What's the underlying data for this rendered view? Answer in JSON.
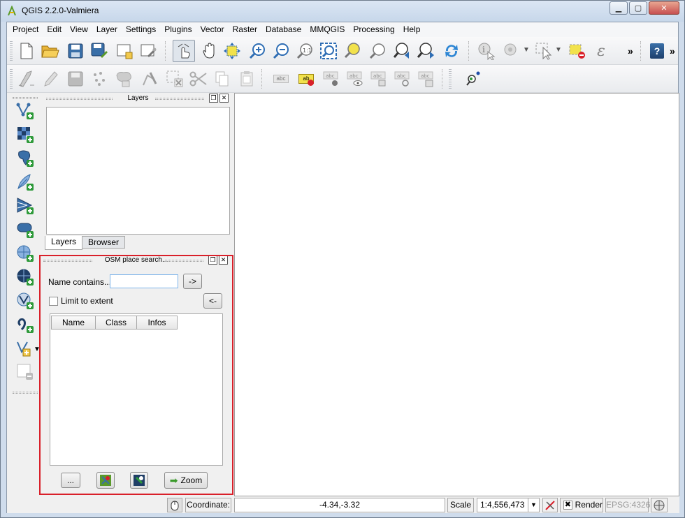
{
  "window": {
    "title": "QGIS 2.2.0-Valmiera",
    "controls": {
      "minimize": "▭",
      "maximize": "▢",
      "close": "✕"
    }
  },
  "menubar": {
    "items": [
      "Project",
      "Edit",
      "View",
      "Layer",
      "Settings",
      "Plugins",
      "Vector",
      "Raster",
      "Database",
      "MMQGIS",
      "Processing",
      "Help"
    ]
  },
  "toolbar1": {
    "icons": [
      "new-project-icon",
      "open-project-icon",
      "save-project-icon",
      "save-as-icon",
      "new-print-composer-icon",
      "composer-manager-icon",
      "touch-zoom-pan-icon",
      "pan-icon",
      "pan-to-selection-icon",
      "zoom-in-icon",
      "zoom-out-icon",
      "zoom-actual-icon",
      "zoom-full-icon",
      "zoom-selection-icon",
      "zoom-layer-icon",
      "zoom-last-icon",
      "zoom-next-icon",
      "refresh-icon",
      "identify-icon",
      "measure-icon",
      "select-icon",
      "deselect-icon",
      "expression-select-icon",
      "help-icon"
    ],
    "overflow": "»",
    "expression_glyph": "ε",
    "help_glyph": "?"
  },
  "toolbar2": {
    "icons": [
      "digitize-icon",
      "edit-pencil-icon",
      "save-edits-icon",
      "add-feature-icon",
      "move-feature-icon",
      "node-tool-icon",
      "delete-selected-icon",
      "cut-icon",
      "copy-icon",
      "paste-icon",
      "label-icon",
      "label-highlight-icon",
      "pin-label-icon",
      "show-hide-label-icon",
      "move-label-icon",
      "rotate-label-icon",
      "change-label-icon",
      "osm-search-icon"
    ],
    "label_text": "abc",
    "label_highlight_text": "ab"
  },
  "left_toolbar": {
    "icons": [
      "add-vector-layer-icon",
      "add-raster-layer-icon",
      "add-postgis-layer-icon",
      "add-spatialite-layer-icon",
      "add-mssql-layer-icon",
      "add-oracle-layer-icon",
      "add-wms-layer-icon",
      "add-wcs-layer-icon",
      "add-wfs-layer-icon",
      "add-delimited-text-icon",
      "new-shapefile-icon",
      "remove-layer-icon"
    ]
  },
  "layers_panel": {
    "title": "Layers",
    "tabs": [
      "Layers",
      "Browser"
    ],
    "float_glyph": "❐",
    "close_glyph": "✕"
  },
  "osm_panel": {
    "title": "OSM place search...",
    "name_label": "Name contains...",
    "name_value": "",
    "go_button": "->",
    "limit_label": "Limit to extent",
    "limit_checked": false,
    "back_button": "<-",
    "columns": [
      "Name",
      "Class",
      "Infos"
    ],
    "rows": [],
    "more_button": "...",
    "zoom_button": "Zoom"
  },
  "statusbar": {
    "coordinate_label": "Coordinate:",
    "coordinate_value": "-4.34,-3.32",
    "scale_label": "Scale",
    "scale_value": "1:4,556,473",
    "render_label": "Render",
    "render_checked": true,
    "crs": "EPSG:4326"
  },
  "colors": {
    "highlight_border": "#d9202a",
    "input_focus": "#7eb4ea"
  }
}
